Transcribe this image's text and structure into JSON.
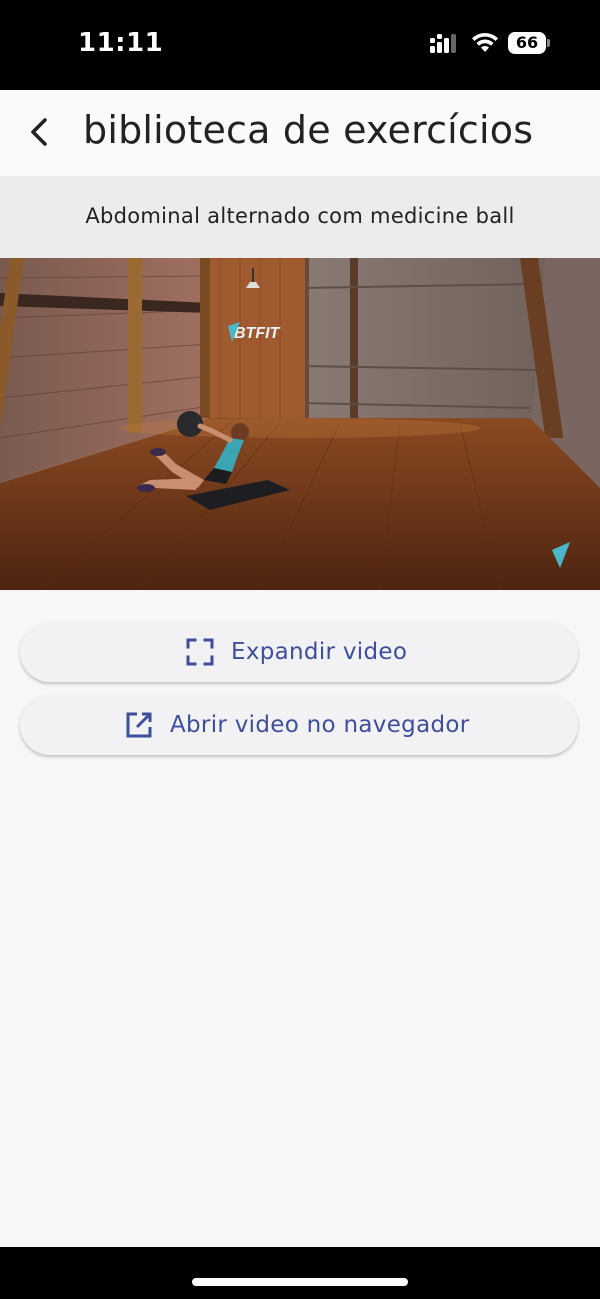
{
  "status_bar": {
    "time": "11:11",
    "battery_level": "66",
    "icons": [
      "cellular-signal-icon",
      "wifi-icon",
      "battery-icon"
    ]
  },
  "header": {
    "title": "biblioteca de exercícios",
    "back_icon": "chevron-left-icon"
  },
  "exercise": {
    "name": "Abdominal alternado com medicine ball",
    "video_watermark": "BTFIT"
  },
  "actions": {
    "expand_label": "Expandir video",
    "expand_icon": "fullscreen-icon",
    "open_browser_label": "Abrir video no navegador",
    "open_browser_icon": "open-in-new-icon"
  },
  "colors": {
    "accent": "#3d4f9a",
    "background": "#f7f7f7",
    "banner": "#ececec",
    "button": "#f2f2f4"
  }
}
